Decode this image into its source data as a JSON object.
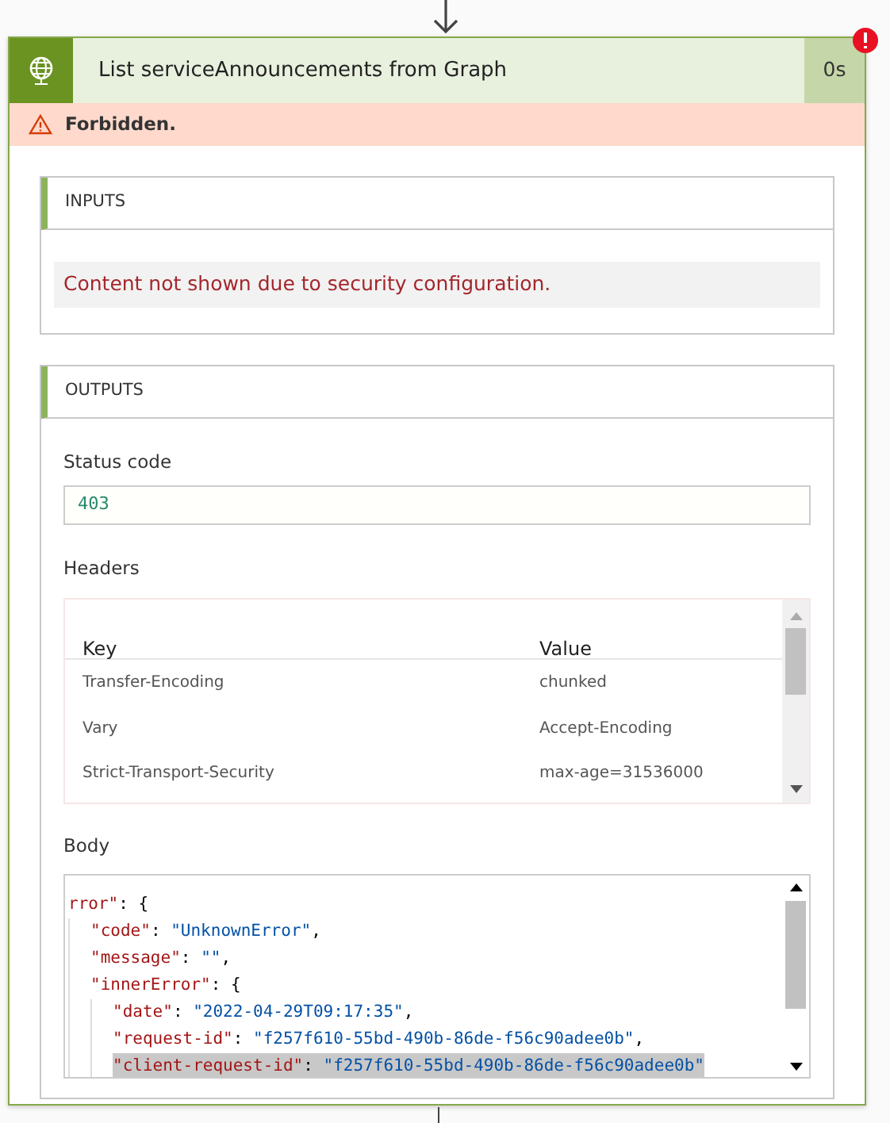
{
  "action": {
    "title": "List serviceAnnouncements from Graph",
    "duration": "0s",
    "has_error": true
  },
  "error": {
    "message": "Forbidden."
  },
  "inputs": {
    "heading": "INPUTS",
    "notice": "Content not shown due to security configuration."
  },
  "outputs": {
    "heading": "OUTPUTS",
    "status_code": {
      "label": "Status code",
      "value": "403"
    },
    "headers": {
      "label": "Headers",
      "columns": [
        "Key",
        "Value"
      ],
      "rows": [
        [
          "Transfer-Encoding",
          "chunked"
        ],
        [
          "Vary",
          "Accept-Encoding"
        ],
        [
          "Strict-Transport-Security",
          "max-age=31536000"
        ]
      ]
    },
    "body": {
      "label": "Body",
      "lines": [
        {
          "key": "rror\"",
          "tail": ": {",
          "children": [
            {
              "key": "\"code\"",
              "sep": ": ",
              "value": "\"UnknownError\"",
              "tail": ","
            },
            {
              "key": "\"message\"",
              "sep": ": ",
              "value": "\"\"",
              "tail": ","
            },
            {
              "key": "\"innerError\"",
              "tail": ": {",
              "children": [
                {
                  "key": "\"date\"",
                  "sep": ": ",
                  "value": "\"2022-04-29T09:17:35\"",
                  "tail": ","
                },
                {
                  "key": "\"request-id\"",
                  "sep": ": ",
                  "value": "\"f257f610-55bd-490b-86de-f56c90adee0b\"",
                  "tail": ","
                },
                {
                  "key": "\"client-request-id\"",
                  "sep": ": ",
                  "value": "\"f257f610-55bd-490b-86de-f56c90adee0b\"",
                  "highlighted": true
                }
              ]
            }
          ]
        }
      ]
    }
  }
}
